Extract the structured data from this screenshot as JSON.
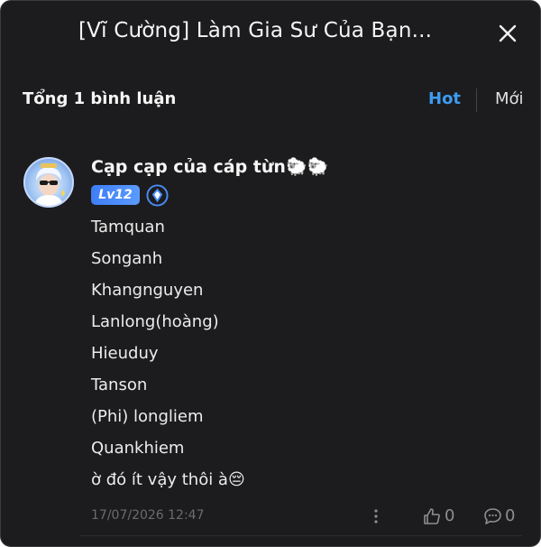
{
  "header": {
    "title": "[Vĩ Cường] Làm Gia Sư Của Bạn...",
    "close_icon": "close-icon"
  },
  "summary": {
    "total_label": "Tổng 1 bình luận",
    "sort_hot": "Hot",
    "sort_new": "Mới",
    "active_sort_color": "#3d9bf0"
  },
  "comment": {
    "username": "Cạp cạp của cáp từn🐑🐑",
    "level_badge": "Lv12",
    "lines": [
      "Tamquan",
      "Songanh",
      "Khangnguyen",
      "Lanlong(hoàng)",
      "Hieuduy",
      "Tanson",
      "(Phi) longliem",
      "Quankhiem",
      "ờ đó ít vậy thôi à😔"
    ],
    "timestamp": "17/07/2026 12:47",
    "like_count": "0",
    "reply_count": "0"
  },
  "colors": {
    "background": "#1c1c1e",
    "accent": "#3d9bf0",
    "level_badge": "#4a8cf7"
  }
}
